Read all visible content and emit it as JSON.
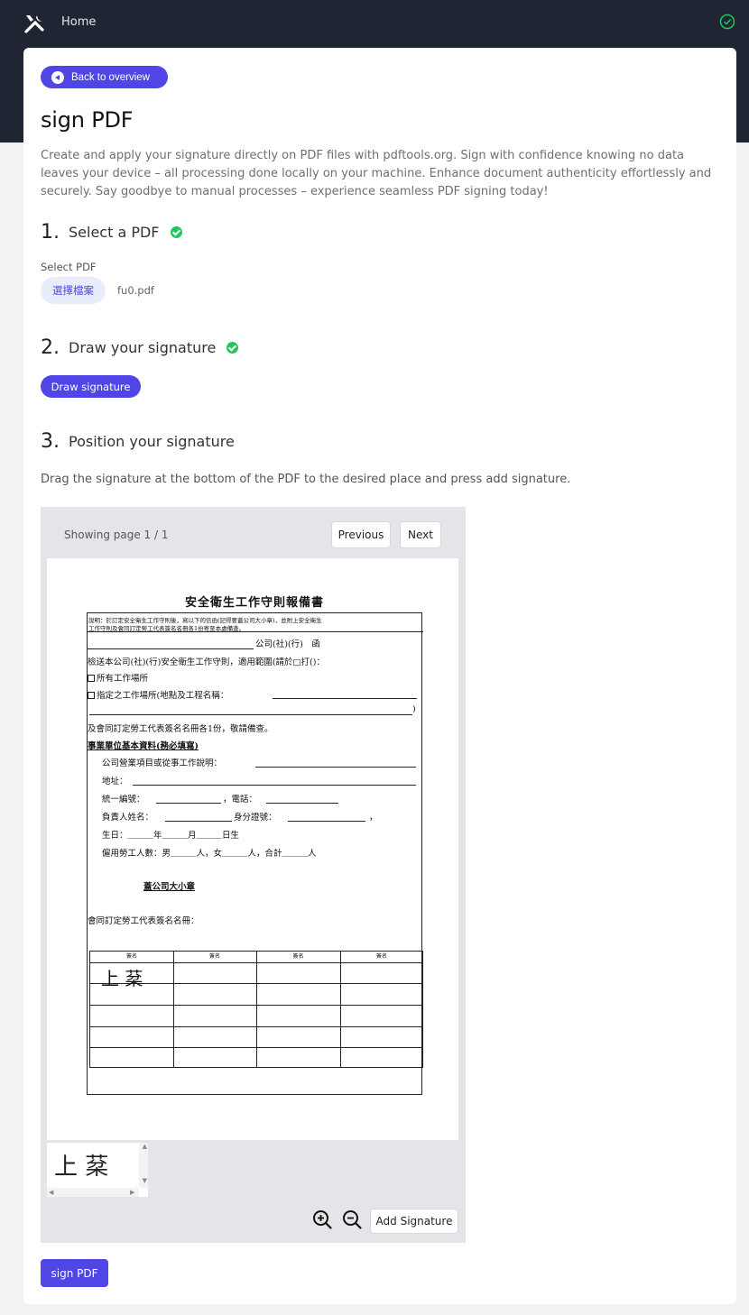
{
  "nav": {
    "home_label": "Home"
  },
  "back_button": {
    "label": "Back to overview"
  },
  "page": {
    "title": "sign PDF",
    "description": "Create and apply your signature directly on PDF files with pdftools.org. Sign with confidence knowing no data leaves your device – all processing done locally on your machine. Enhance document authenticity effortlessly and securely. Say goodbye to manual processes – experience seamless PDF signing today!"
  },
  "steps": [
    {
      "number": "1.",
      "label": "Select a PDF",
      "done": true
    },
    {
      "number": "2.",
      "label": "Draw your signature",
      "done": true
    },
    {
      "number": "3.",
      "label": "Position your signature",
      "done": false
    }
  ],
  "file_select": {
    "label": "Select PDF",
    "button": "選擇檔案",
    "file_name": "fu0.pdf"
  },
  "draw_button": {
    "label": "Draw signature"
  },
  "position": {
    "instruction": "Drag the signature at the bottom of the PDF to the desired place and press add signature."
  },
  "viewer": {
    "page_status": "Showing page 1 / 1",
    "previous": "Previous",
    "next": "Next",
    "add_signature": "Add Signature",
    "zoom_in_icon": "zoom-in-icon",
    "zoom_out_icon": "zoom-out-icon"
  },
  "document": {
    "title": "安全衛生工作守則報備書",
    "note_line1": "說明：於訂定安全衛生工作守則後，寫以下的信函(記得要蓋公司大小章)，並附上安全衛生",
    "note_line2": "工作守則及會同訂定勞工代表簽名名冊各1份寄至本處備查。",
    "company_suffix": "公司(社)(行)　函",
    "line_send": "檢送本公司(社)(行)安全衛生工作守則，適用範圍(請於□打()：",
    "opt_all": "所有工作場所",
    "opt_specific": "指定之工作場所(地點及工程名稱：",
    "close_paren": ")",
    "line_attach": "及會同訂定勞工代表簽名名冊各1份，敬請備查。",
    "section_head": "事業單位基本資料(務必填寫)",
    "field_business": "公司營業項目或從事工作說明：",
    "field_address": "地址：",
    "field_id": "統一編號：",
    "field_phone": "，電話：",
    "field_owner": "負責人姓名：",
    "field_idno": "身分證號：",
    "field_comma": "，",
    "field_birth": "生日：＿＿＿年＿＿＿月＿＿＿日生",
    "field_workers": "僱用勞工人數：男＿＿＿人，女＿＿＿人，合計＿＿＿人",
    "stamp": "蓋公司大小章",
    "roster_head": "會同訂定勞工代表簽名名冊：",
    "col_header": "簽名",
    "signature_text": "上 棻"
  },
  "signature_preview": "上 棻",
  "sign_button": {
    "label": "sign PDF"
  },
  "colors": {
    "accent": "#4f46e5",
    "header_bg": "#1f2533",
    "success": "#22c55e"
  }
}
